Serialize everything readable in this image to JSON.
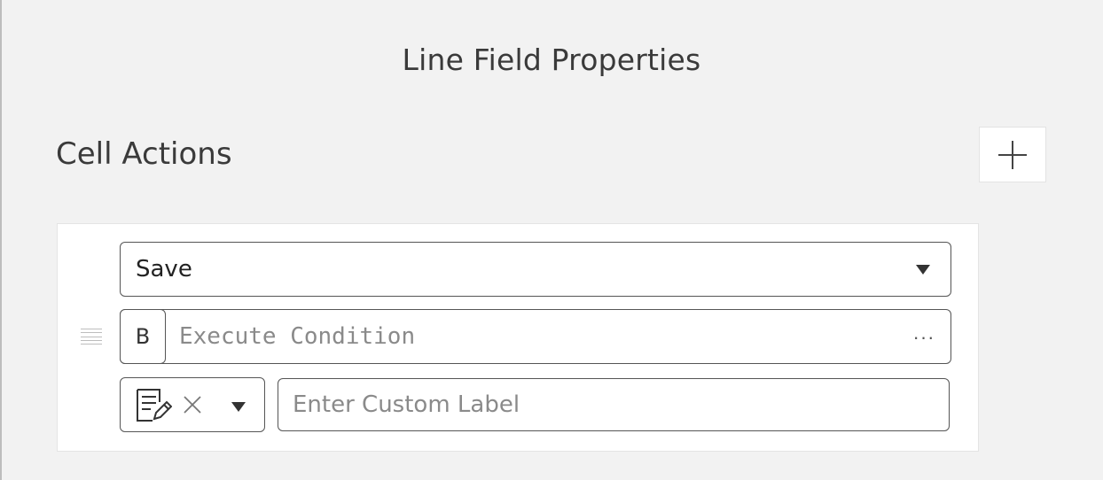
{
  "panel": {
    "title": "Line Field Properties"
  },
  "section": {
    "title": "Cell Actions",
    "add_icon": "plus-icon"
  },
  "action": {
    "selected": "Save",
    "condition": {
      "toggle_label": "B",
      "placeholder": "Execute Condition",
      "value": "",
      "more_label": "···"
    },
    "icon_picker": {
      "selected_icon": "edit-form-icon",
      "clear_icon": "close-icon",
      "dropdown_icon": "chevron-down-icon"
    },
    "custom_label": {
      "placeholder": "Enter Custom Label",
      "value": ""
    }
  }
}
